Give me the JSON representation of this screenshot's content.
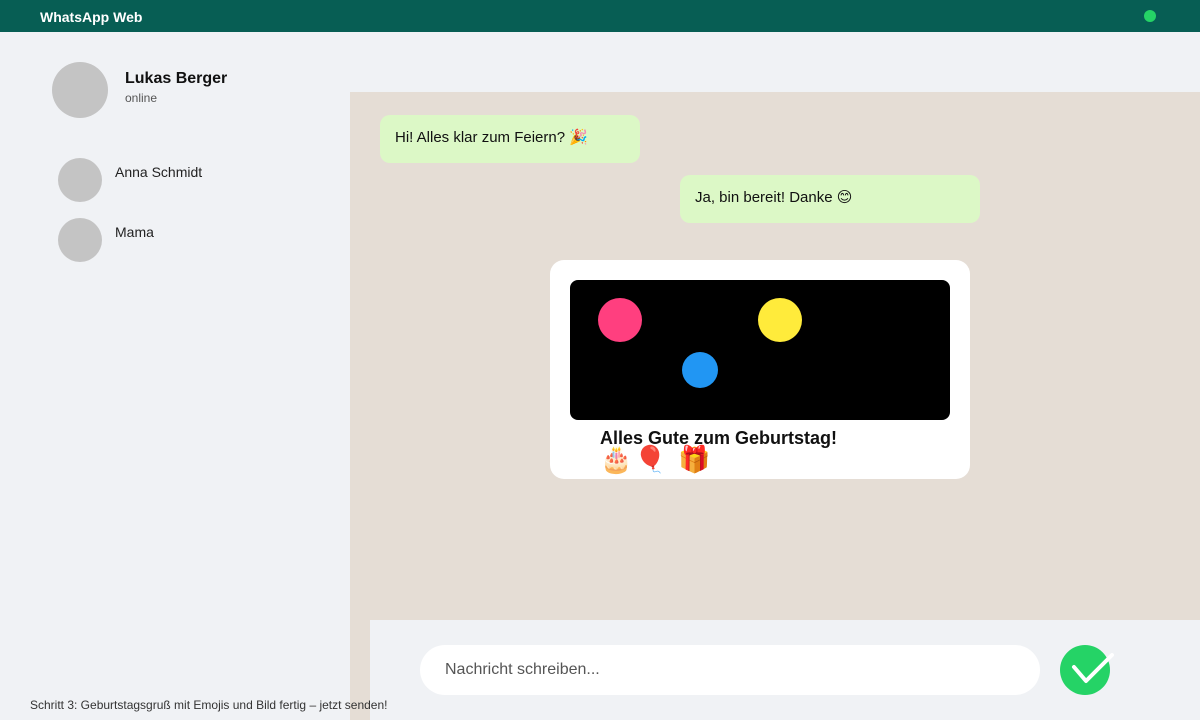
{
  "app": {
    "title": "WhatsApp Web"
  },
  "contact": {
    "name": "Lukas Berger",
    "status": "online"
  },
  "chats": [
    {
      "name": "Anna Schmidt"
    },
    {
      "name": "Mama"
    }
  ],
  "messages": [
    {
      "direction": "incoming",
      "text": "Hi! Alles klar zum Feiern? 🎉"
    },
    {
      "direction": "outgoing",
      "text": "Ja, bin bereit! Danke 😊"
    }
  ],
  "card": {
    "caption": "Alles Gute zum Geburtstag!",
    "emojis": "🎂🎈 🎁"
  },
  "composer": {
    "placeholder": "Nachricht schreiben..."
  },
  "hint": "Schritt 3: Geburtstagsgruß mit Emojis und Bild fertig – jetzt senden!",
  "colors": {
    "header": "#075e54",
    "accent": "#25d366",
    "bubble": "#dcf8c6",
    "chat_background": "#e5ddd5"
  },
  "icons": {
    "status": "online-dot-icon",
    "send": "checkmark-send-icon"
  }
}
